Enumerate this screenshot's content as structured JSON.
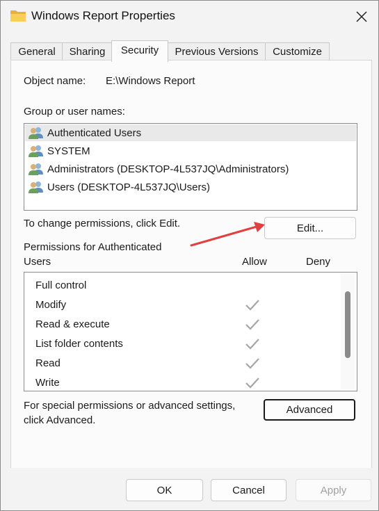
{
  "window": {
    "title": "Windows Report Properties",
    "icon": "folder-icon",
    "close_icon": "close-icon"
  },
  "tabs": [
    {
      "label": "General",
      "active": false
    },
    {
      "label": "Sharing",
      "active": false
    },
    {
      "label": "Security",
      "active": true
    },
    {
      "label": "Previous Versions",
      "active": false
    },
    {
      "label": "Customize",
      "active": false
    }
  ],
  "security": {
    "object_name_label": "Object name:",
    "object_name_value": "E:\\Windows Report",
    "group_label": "Group or user names:",
    "users": [
      {
        "name": "Authenticated Users",
        "selected": true,
        "icon": "users-group-icon"
      },
      {
        "name": "SYSTEM",
        "selected": false,
        "icon": "users-group-icon"
      },
      {
        "name": "Administrators (DESKTOP-4L537JQ\\Administrators)",
        "selected": false,
        "icon": "users-group-icon"
      },
      {
        "name": "Users (DESKTOP-4L537JQ\\Users)",
        "selected": false,
        "icon": "users-group-icon"
      }
    ],
    "change_hint": "To change permissions, click Edit.",
    "edit_button": "Edit...",
    "permissions_header_line1": "Permissions for Authenticated",
    "permissions_header_line2": "Users",
    "allow_header": "Allow",
    "deny_header": "Deny",
    "permissions": [
      {
        "name": "Full control",
        "allow": false,
        "deny": false
      },
      {
        "name": "Modify",
        "allow": true,
        "deny": false
      },
      {
        "name": "Read & execute",
        "allow": true,
        "deny": false
      },
      {
        "name": "List folder contents",
        "allow": true,
        "deny": false
      },
      {
        "name": "Read",
        "allow": true,
        "deny": false
      },
      {
        "name": "Write",
        "allow": true,
        "deny": false
      }
    ],
    "advanced_hint_line1": "For special permissions or advanced settings,",
    "advanced_hint_line2": "click Advanced.",
    "advanced_button": "Advanced"
  },
  "footer": {
    "ok": "OK",
    "cancel": "Cancel",
    "apply": "Apply"
  },
  "colors": {
    "annotation_arrow": "#e04040",
    "check_gray": "#a6a6a6",
    "selection": "#e9e9e9"
  }
}
